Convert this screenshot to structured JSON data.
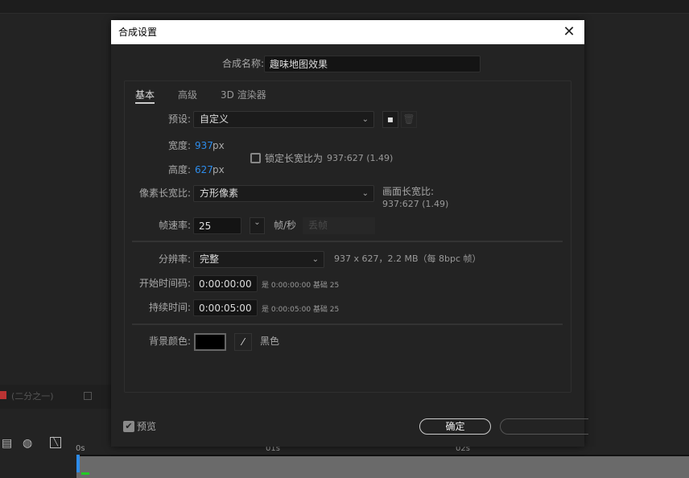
{
  "dialog": {
    "title": "合成设置",
    "close_icon": "close-icon"
  },
  "comp_name": {
    "label": "合成名称:",
    "value": "趣味地图效果"
  },
  "tabs": [
    {
      "label": "基本"
    },
    {
      "label": "高级"
    },
    {
      "label": "3D 渲染器"
    }
  ],
  "preset": {
    "label": "预设:",
    "value": "自定义"
  },
  "width": {
    "label": "宽度:",
    "value": "937",
    "unit": "px"
  },
  "height": {
    "label": "高度:",
    "value": "627",
    "unit": "px"
  },
  "lock": {
    "label": "锁定长宽比为",
    "ratio": "937:627 (1.49)"
  },
  "pixel_aspect": {
    "label": "像素长宽比:",
    "value": "方形像素"
  },
  "frame_aspect": {
    "label": "画面长宽比:",
    "value": "937:627 (1.49)"
  },
  "frame_rate": {
    "label": "帧速率:",
    "value": "25",
    "unit": "帧/秒",
    "drop": "丢帧"
  },
  "resolution": {
    "label": "分辨率:",
    "value": "完整",
    "info": "937 x 627，2.2 MB（每 8bpc 帧）"
  },
  "start_tc": {
    "label": "开始时间码:",
    "value": "0:00:00:00",
    "info": "是 0:00:00:00  基础 25"
  },
  "duration": {
    "label": "持续时间:",
    "value": "0:00:05:00",
    "info": "是 0:00:05:00  基础 25"
  },
  "bg_color": {
    "label": "背景颜色:",
    "name": "黑色",
    "color": "#000000"
  },
  "footer": {
    "preview": "预览",
    "ok": "确定"
  },
  "background": {
    "resolution": "(二分之一)",
    "ticks": [
      "0s",
      "01s",
      "02s"
    ]
  },
  "colors": {
    "accent": "#2d8ceb",
    "playhead": "#2d8ceb"
  }
}
